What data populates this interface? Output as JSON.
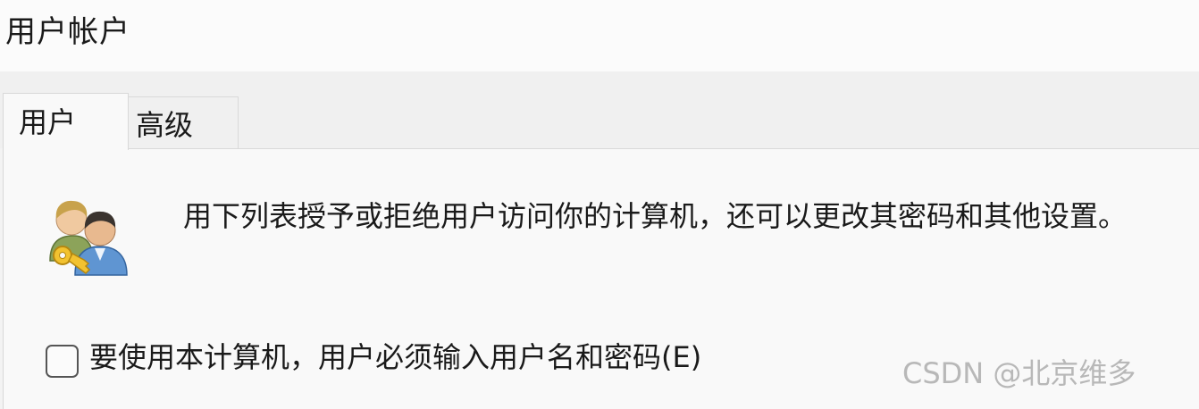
{
  "window": {
    "title": "用户帐户"
  },
  "tabs": [
    {
      "label": "用户",
      "selected": true
    },
    {
      "label": "高级",
      "selected": false
    }
  ],
  "users_tab": {
    "icon": "users-key-icon",
    "description": "用下列表授予或拒绝用户访问你的计算机，还可以更改其密码和其他设置。",
    "require_password_checkbox": {
      "label": "要使用本计算机，用户必须输入用户名和密码(E)",
      "checked": false
    }
  },
  "watermark": "CSDN @北京维多",
  "colors": {
    "titlebar_bg": "#fbfbfb",
    "window_bg": "#f3f3f3",
    "panel_bg": "#f9f9f9",
    "border": "#d9d9d9"
  }
}
